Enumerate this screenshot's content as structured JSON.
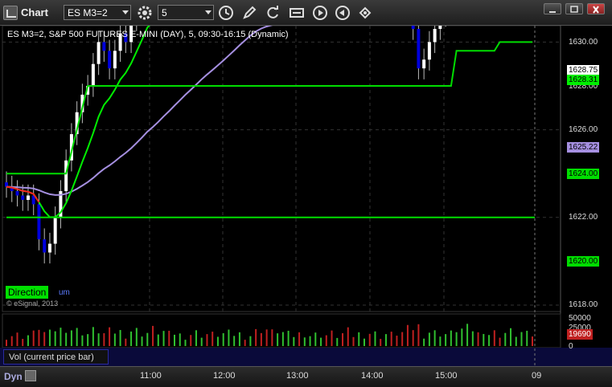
{
  "window": {
    "title": "Chart",
    "symbol": "ES M3=2",
    "interval": "5",
    "icons": [
      "settings-gear-icon",
      "clock-icon",
      "pencil-icon",
      "refresh-icon",
      "data-icon",
      "play-icon",
      "rewind-icon",
      "link-icon"
    ]
  },
  "chart": {
    "title": "ES M3=2, S&P 500 FUTURES E-MINI (DAY), 5, 09:30-16:15 (Dynamic)",
    "direction_label": "Direction",
    "direction_tail": "um",
    "copyright": "© eSignal, 2013",
    "price_ticks": [
      "1630.00",
      "1628.00",
      "1626.00",
      "1624.00",
      "1622.00",
      "1620.00",
      "1618.00"
    ],
    "price_tags": {
      "last": "1628.75",
      "green_avg": "1628.31",
      "purple_avg": "1625.22",
      "green_step": "1624.00",
      "green_base": "1620.00"
    },
    "colors": {
      "background": "#000000",
      "up_candle": "#ffffff",
      "down_candle": "#0000dd",
      "fast_avg": "#00ee00",
      "slow_avg": "#a58fe0",
      "step_line": "#00dd00",
      "red_line": "#ff2020",
      "vol_up": "#30c030",
      "vol_down": "#c02020"
    }
  },
  "volume": {
    "label": "Vol (current price bar)",
    "ticks": [
      "50000",
      "25000",
      "0"
    ],
    "last": "19690"
  },
  "time_axis": [
    "11:00",
    "12:00",
    "13:00",
    "14:00",
    "15:00",
    "09"
  ],
  "footer": {
    "mode": "Dyn"
  },
  "chart_data": {
    "type": "candlestick",
    "title": "ES M3=2, S&P 500 FUTURES E-MINI (DAY), 5, 09:30-16:15 (Dynamic)",
    "ylim": [
      1618,
      1630.5
    ],
    "y_ticks": [
      1618,
      1620,
      1622,
      1624,
      1626,
      1628,
      1630
    ],
    "x_ticks": [
      "11:00",
      "12:00",
      "13:00",
      "14:00",
      "15:00",
      "09"
    ],
    "lines": {
      "green_base_level": 1620.0,
      "green_step_last": 1624.0,
      "purple_avg_last": 1625.22,
      "green_avg_last": 1628.31,
      "last_price": 1628.75
    },
    "volume_last": 19690,
    "volume_ticks": [
      0,
      25000,
      50000
    ]
  }
}
